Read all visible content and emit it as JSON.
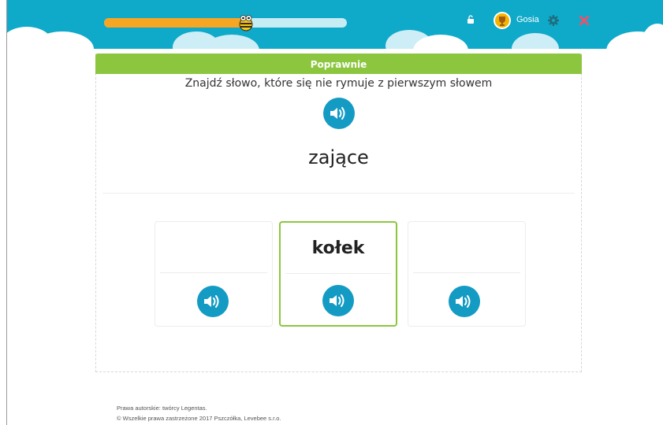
{
  "header": {
    "progress_fraction": 0.57,
    "user_name": "Gosia",
    "colors": {
      "header_bg": "#0fa9c9",
      "progress_fill": "#f6a623",
      "close": "#e8546b"
    }
  },
  "exercise": {
    "status": "Poprawnie",
    "instruction": "Znajdź słowo, które się nie rymuje z pierwszym słowem",
    "target_word": "zające",
    "options": [
      {
        "word": "",
        "selected": false
      },
      {
        "word": "kołek",
        "selected": true
      },
      {
        "word": "",
        "selected": false
      }
    ]
  },
  "footer": {
    "line1": "Prawa autorskie: twórcy Legentas.",
    "line2": "© Wszelkie prawa zastrzeżone 2017 Pszczółka, Levebee s.r.o."
  },
  "icons": [
    "bee-icon",
    "unlock-icon",
    "trophy-avatar-icon",
    "gear-icon",
    "close-icon",
    "speaker-icon"
  ]
}
